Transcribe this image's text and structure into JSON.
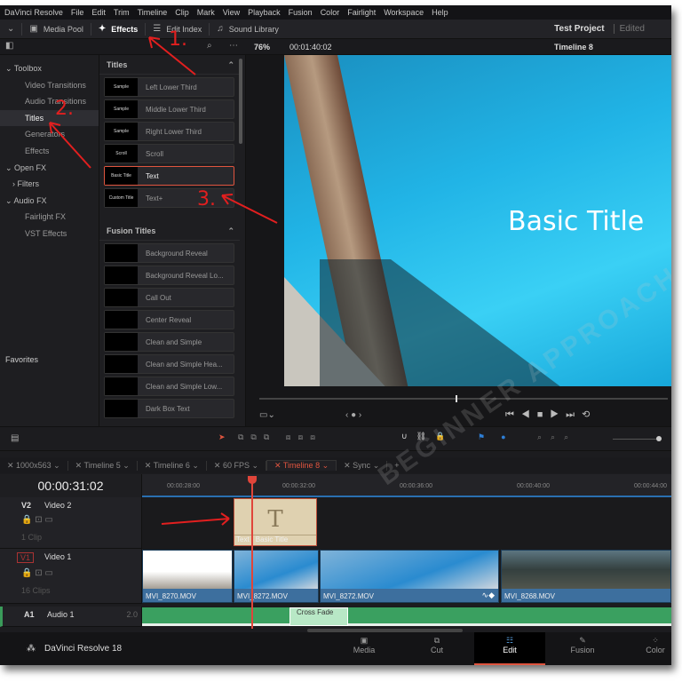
{
  "menu": [
    "DaVinci Resolve",
    "File",
    "Edit",
    "Trim",
    "Timeline",
    "Clip",
    "Mark",
    "View",
    "Playback",
    "Fusion",
    "Color",
    "Fairlight",
    "Workspace",
    "Help"
  ],
  "toolbar": {
    "media_pool": "Media Pool",
    "effects": "Effects",
    "edit_index": "Edit Index",
    "sound_library": "Sound Library",
    "project": "Test Project",
    "status": "Edited"
  },
  "viewer": {
    "zoom": "76%",
    "timecode": "00:01:40:02",
    "timeline": "Timeline 8",
    "overlay_title": "Basic Title"
  },
  "sidebar": {
    "items": [
      {
        "label": "Toolbox",
        "cat": true
      },
      {
        "label": "Video Transitions"
      },
      {
        "label": "Audio Transitions"
      },
      {
        "label": "Titles",
        "sel": true
      },
      {
        "label": "Generators"
      },
      {
        "label": "Effects"
      },
      {
        "label": "Open FX",
        "cat": true
      },
      {
        "label": "Filters",
        "cat": true
      },
      {
        "label": "Audio FX",
        "cat": true
      },
      {
        "label": "Fairlight FX"
      },
      {
        "label": "VST Effects"
      }
    ],
    "favorites": "Favorites"
  },
  "titles": {
    "header": "Titles",
    "items": [
      {
        "thumb": "Sample",
        "label": "Left Lower Third"
      },
      {
        "thumb": "Sample",
        "label": "Middle Lower Third"
      },
      {
        "thumb": "Sample",
        "label": "Right Lower Third"
      },
      {
        "thumb": "Scroll",
        "label": "Scroll"
      },
      {
        "thumb": "Basic Title",
        "label": "Text",
        "sel": true
      },
      {
        "thumb": "Custom Title",
        "label": "Text+"
      }
    ]
  },
  "fusion_titles": {
    "header": "Fusion Titles",
    "items": [
      "Background Reveal",
      "Background Reveal Lo...",
      "Call Out",
      "Center Reveal",
      "Clean and Simple",
      "Clean and Simple Hea...",
      "Clean and Simple Low...",
      "Dark Box Text"
    ]
  },
  "tabs": [
    "1000x563",
    "Timeline 5",
    "Timeline 6",
    "60 FPS",
    "Timeline 8",
    "Sync"
  ],
  "timeline": {
    "timecode": "00:00:31:02",
    "ruler": [
      "00:00:28:00",
      "00:00:32:00",
      "00:00:36:00",
      "00:00:40:00",
      "00:00:44:00"
    ],
    "tracks": [
      {
        "id": "V2",
        "name": "Video 2",
        "count": "1 Clip"
      },
      {
        "id": "V1",
        "name": "Video 1",
        "count": "16 Clips"
      },
      {
        "id": "A1",
        "name": "Audio 1",
        "ch": "2.0"
      }
    ],
    "title_clip": "Text - Basic Title",
    "title_glyph": "T",
    "clips": [
      "MVI_8270.MOV",
      "MVI_8272.MOV",
      "MVI_8272.MOV",
      "MVI_8268.MOV"
    ],
    "transition": "Cross Fade"
  },
  "bottom": {
    "app": "DaVinci Resolve 18",
    "pages": [
      "Media",
      "Cut",
      "Edit",
      "Fusion",
      "Color"
    ],
    "active": "Edit"
  },
  "annotations": [
    "1.",
    "2.",
    "3."
  ],
  "watermark": "BEGINNER APPROACH"
}
